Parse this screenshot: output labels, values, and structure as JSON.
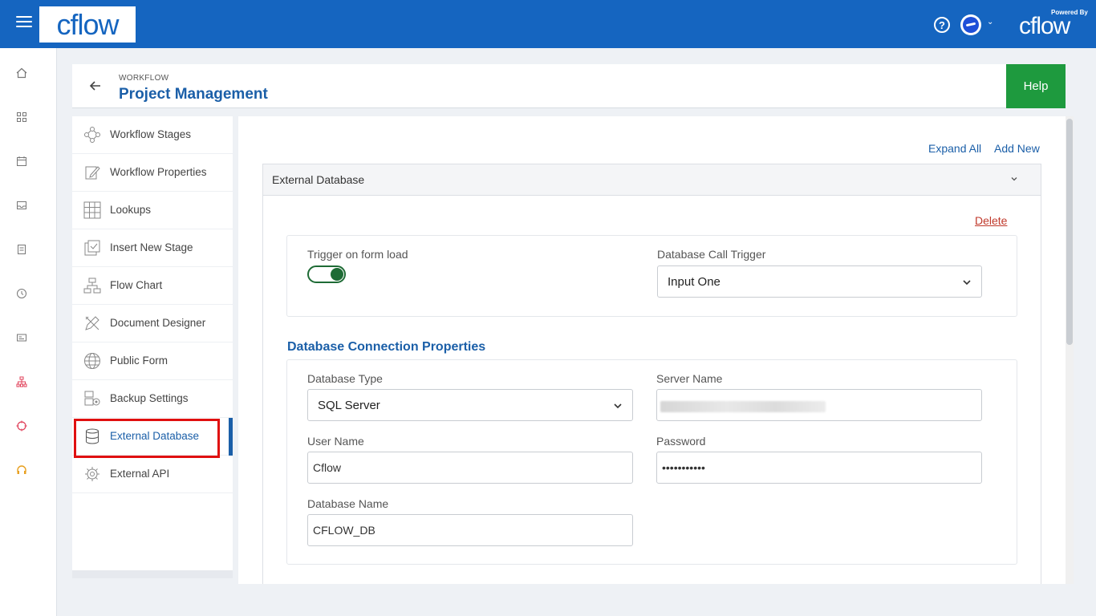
{
  "app": {
    "logo_text": "cflow",
    "powered_by": "Powered By",
    "powered_logo": "cflow"
  },
  "header": {
    "crumb": "WORKFLOW",
    "title": "Project Management",
    "help_label": "Help"
  },
  "rail_icons": [
    "home-icon",
    "grid-icon",
    "calendar-icon",
    "inbox-icon",
    "report-icon",
    "history-icon",
    "card-icon",
    "org-chart-icon",
    "target-icon",
    "headset-icon"
  ],
  "sidemenu": {
    "items": [
      {
        "label": "Workflow Stages",
        "icon": "workflow-stages-icon"
      },
      {
        "label": "Workflow Properties",
        "icon": "workflow-properties-icon"
      },
      {
        "label": "Lookups",
        "icon": "lookups-icon"
      },
      {
        "label": "Insert New Stage",
        "icon": "insert-stage-icon"
      },
      {
        "label": "Flow Chart",
        "icon": "flow-chart-icon"
      },
      {
        "label": "Document Designer",
        "icon": "document-designer-icon"
      },
      {
        "label": "Public Form",
        "icon": "globe-icon"
      },
      {
        "label": "Backup Settings",
        "icon": "backup-icon"
      },
      {
        "label": "External Database",
        "icon": "database-icon"
      },
      {
        "label": "External API",
        "icon": "api-gear-icon"
      }
    ],
    "active_index": 8
  },
  "main": {
    "expand_all": "Expand All",
    "add_new": "Add New",
    "accordion_title": "External Database",
    "delete_label": "Delete",
    "trigger_label": "Trigger on form load",
    "trigger_on": true,
    "db_call_trigger_label": "Database Call Trigger",
    "db_call_trigger_value": "Input One",
    "section_title": "Database Connection Properties",
    "db_type_label": "Database Type",
    "db_type_value": "SQL Server",
    "server_name_label": "Server Name",
    "user_name_label": "User Name",
    "user_name_value": "Cflow",
    "password_label": "Password",
    "password_value": "•••••••••••",
    "db_name_label": "Database Name",
    "db_name_value": "CFLOW_DB"
  },
  "colors": {
    "topbar": "#1565c0",
    "accent": "#1b5fa8",
    "help_button": "#1e9a3e",
    "toggle_on": "#1e6b35",
    "delete": "#c0392b",
    "highlight": "#e01010"
  }
}
